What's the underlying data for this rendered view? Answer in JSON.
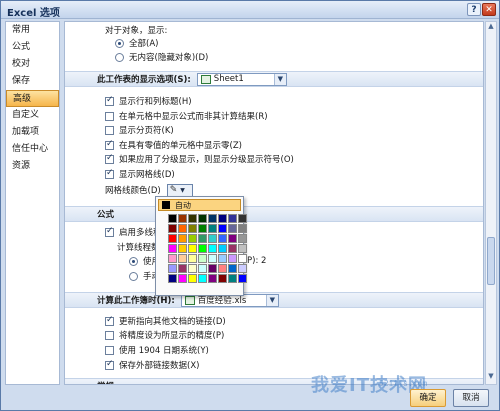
{
  "window": {
    "title": "Excel 选项",
    "help": "?",
    "close": "✕"
  },
  "nav": {
    "items": [
      {
        "label": "常用",
        "active": false
      },
      {
        "label": "公式",
        "active": false
      },
      {
        "label": "校对",
        "active": false
      },
      {
        "label": "保存",
        "active": false
      },
      {
        "label": "高级",
        "active": true
      },
      {
        "label": "自定义",
        "active": false
      },
      {
        "label": "加载项",
        "active": false
      },
      {
        "label": "信任中心",
        "active": false
      },
      {
        "label": "资源",
        "active": false
      }
    ]
  },
  "objects": {
    "heading": "对于对象，显示:",
    "opt_all": "全部(A)",
    "opt_none": "无内容(隐藏对象)(D)"
  },
  "sheet_section": {
    "title": "此工作表的显示选项(S):",
    "combo_value": "Sheet1",
    "options": [
      {
        "label": "显示行和列标题(H)",
        "checked": true
      },
      {
        "label": "在单元格中显示公式而非其计算结果(R)",
        "checked": false
      },
      {
        "label": "显示分页符(K)",
        "checked": false
      },
      {
        "label": "在具有零值的单元格中显示零(Z)",
        "checked": true
      },
      {
        "label": "如果应用了分级显示，则显示分级显示符号(O)",
        "checked": true
      },
      {
        "label": "显示网格线(D)",
        "checked": true
      }
    ],
    "gridline_color_label": "网格线颜色(D)"
  },
  "color_popup": {
    "auto_label": "自动",
    "colors": [
      "#000000",
      "#993300",
      "#333300",
      "#003300",
      "#003366",
      "#000080",
      "#333399",
      "#333333",
      "#800000",
      "#FF6600",
      "#808000",
      "#008000",
      "#008080",
      "#0000FF",
      "#666699",
      "#808080",
      "#FF0000",
      "#FF9900",
      "#99CC00",
      "#339966",
      "#33CCCC",
      "#3366FF",
      "#800080",
      "#969696",
      "#FF00FF",
      "#FFCC00",
      "#FFFF00",
      "#00FF00",
      "#00FFFF",
      "#00CCFF",
      "#993366",
      "#C0C0C0",
      "#FF99CC",
      "#FFCC99",
      "#FFFF99",
      "#CCFFCC",
      "#CCFFFF",
      "#99CCFF",
      "#CC99FF",
      "#FFFFFF",
      "#9999FF",
      "#993366",
      "#FFFFCC",
      "#CCFFFF",
      "#660066",
      "#FF8080",
      "#0066CC",
      "#CCCCFF",
      "#000080",
      "#FF00FF",
      "#FFFF00",
      "#00FFFF",
      "#800080",
      "#800000",
      "#008080",
      "#0000FF"
    ]
  },
  "formula_section": {
    "title": "公式",
    "multi_thread": "启用多线程",
    "threads_label": "计算线程数",
    "use_all": "使用",
    "manual": "手动",
    "cpu_suffix": "P): 2"
  },
  "workbook_section": {
    "title": "计算此工作簿时(H):",
    "combo_value": "百度经验.xls",
    "options": [
      {
        "label": "更新指向其他文档的链接(D)",
        "checked": true
      },
      {
        "label": "将精度设为所显示的精度(P)",
        "checked": false
      },
      {
        "label": "使用 1904 日期系统(Y)",
        "checked": false
      },
      {
        "label": "保存外部链接数据(X)",
        "checked": true
      }
    ]
  },
  "general_section": {
    "title": "常规"
  },
  "buttons": {
    "ok": "确定",
    "cancel": "取消"
  },
  "watermark": {
    "text": "我爱IT技术网",
    "sub": "52itjs.com"
  }
}
